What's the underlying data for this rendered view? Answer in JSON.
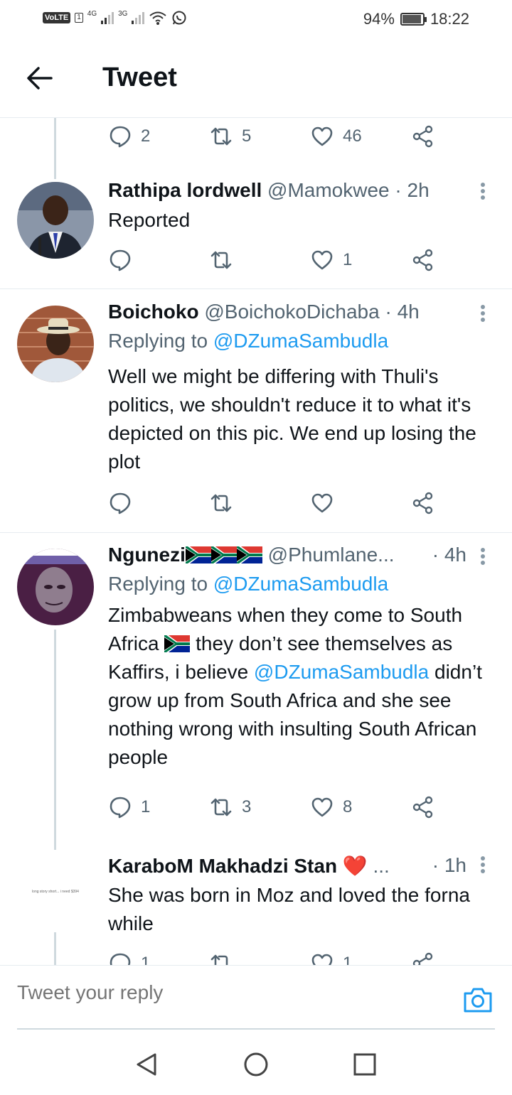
{
  "status_bar": {
    "volte": "VoLTE",
    "sim": "1",
    "net1": "4G",
    "net2": "3G",
    "battery": "94%",
    "battery_level": 0.94,
    "time": "18:22"
  },
  "header": {
    "title": "Tweet"
  },
  "top_actions": {
    "replies": "2",
    "retweets": "5",
    "likes": "46"
  },
  "tweets": [
    {
      "name": "Rathipa lordwell",
      "handle": "@Mamokwee · 2h",
      "text": "Reported",
      "replies": "",
      "retweets": "",
      "likes": "1"
    },
    {
      "name": "Boichoko",
      "handle": "@BoichokoDichaba · 4h",
      "reply_prefix": "Replying to ",
      "reply_to": "@DZumaSambudla",
      "text": "Well we might be differing with Thuli's politics, we shouldn't reduce it to what it's depicted on this pic. We end up losing the plot",
      "replies": "",
      "retweets": "",
      "likes": ""
    },
    {
      "name": "Ngunezi",
      "handle": "@Phumlane...",
      "time": "· 4h",
      "reply_prefix": "Replying to ",
      "reply_to": "@DZumaSambudla",
      "text_a": "Zimbabweans when they come to South Africa",
      "text_b": " they don’t see themselves as Kaffirs, i believe ",
      "mention": "@DZumaSambudla",
      "text_c": " didn’t grow up from South Africa and she see nothing wrong with insulting South African people",
      "replies": "1",
      "retweets": "3",
      "likes": "8"
    },
    {
      "name": "KaraboM Makhadzi Stan",
      "heart": "❤️",
      "ellipsis": "...",
      "time": "· 1h",
      "avatar_text": "long story short... i need $394",
      "text": "She was born in Moz and loved the forna while",
      "replies": "1",
      "retweets": "",
      "likes": "1"
    }
  ],
  "reply_bar": {
    "placeholder": "Tweet your reply"
  }
}
